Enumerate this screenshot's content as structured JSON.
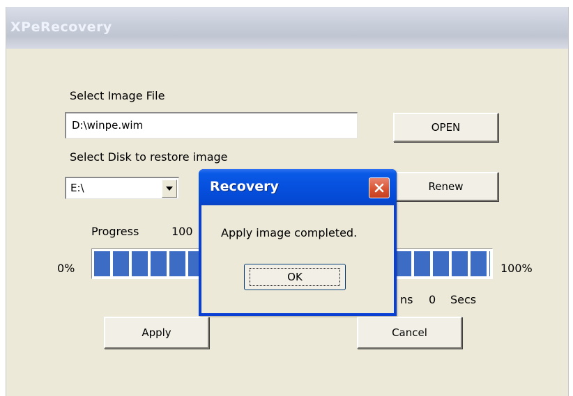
{
  "window": {
    "title": "XPeRecovery"
  },
  "image_file": {
    "label": "Select Image File",
    "value": "D:\\winpe.wim",
    "open_button": "OPEN"
  },
  "disk": {
    "label": "Select Disk to restore image",
    "selected": "E:\\",
    "renew_button": "Renew"
  },
  "progress": {
    "label": "Progress",
    "value_text": "100",
    "min_label": "0%",
    "max_label": "100%",
    "percent": 100,
    "time_remaining_partial": "ns",
    "seconds_value": "0",
    "seconds_label": "Secs"
  },
  "actions": {
    "apply": "Apply",
    "cancel": "Cancel"
  },
  "dialog": {
    "title": "Recovery",
    "message": "Apply image completed.",
    "ok": "OK"
  },
  "icons": {
    "dropdown": "chevron-down-icon",
    "close": "close-icon"
  },
  "colors": {
    "progress_fill": "#3c6cc4",
    "dialog_title": "#0650de",
    "close_button": "#d6512f",
    "window_bg": "#ece9d8"
  }
}
